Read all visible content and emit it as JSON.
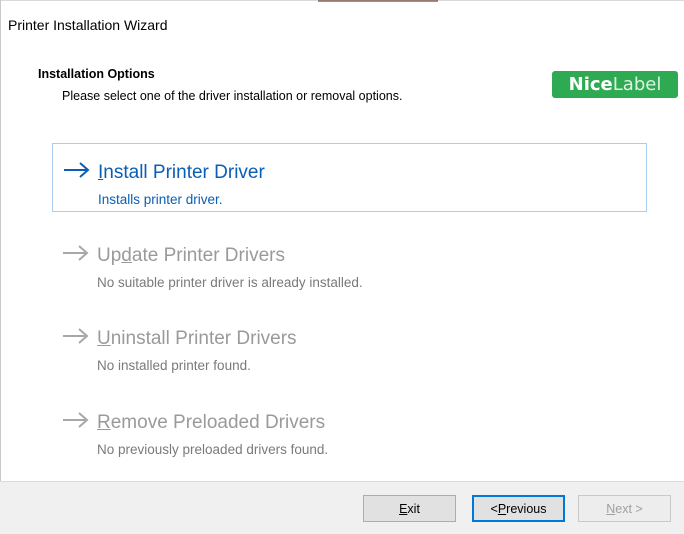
{
  "window": {
    "title": "Printer Installation Wizard"
  },
  "header": {
    "title": "Installation Options",
    "subtitle": "Please select one of the driver installation or removal options.",
    "logo_text_bold": "Nice",
    "logo_text_light": "Label"
  },
  "options": [
    {
      "title_pre": "",
      "title_key": "I",
      "title_post": "nstall Printer Driver",
      "description": "Installs printer driver.",
      "state": "selected"
    },
    {
      "title_pre": "Up",
      "title_key": "d",
      "title_post": "ate Printer Drivers",
      "description": "No suitable printer driver is already installed.",
      "state": "disabled"
    },
    {
      "title_pre": "",
      "title_key": "U",
      "title_post": "ninstall Printer Drivers",
      "description": "No installed printer found.",
      "state": "disabled"
    },
    {
      "title_pre": "",
      "title_key": "R",
      "title_post": "emove Preloaded Drivers",
      "description": "No previously preloaded drivers found.",
      "state": "disabled"
    }
  ],
  "buttons": {
    "exit": {
      "key": "E",
      "rest": "xit"
    },
    "previous": {
      "pre": "< ",
      "key": "P",
      "rest": "revious"
    },
    "next": {
      "key": "N",
      "rest": "ext >"
    }
  },
  "colors": {
    "accent": "#0a5fb4",
    "disabled": "#9a9a9a",
    "logo": "#2eaa52"
  }
}
